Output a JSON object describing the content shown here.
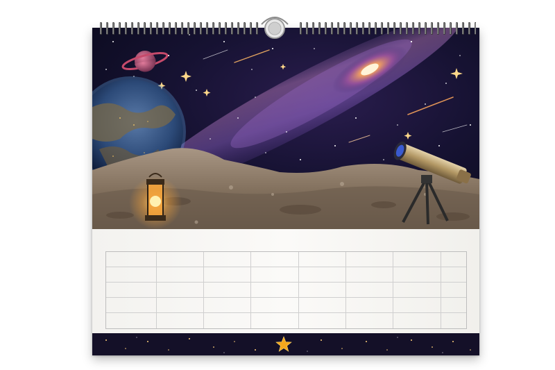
{
  "calendar": {
    "colors": {
      "sky": "#12102a",
      "galaxy": "#8a5fb8",
      "lunar_ground": "#8b7b6c",
      "lantern_glow": "#f6a33a",
      "planet_ring": "#c64a6b",
      "footer": "#141028",
      "star_badge": "#f4a81d"
    },
    "artwork": {
      "elements": [
        "ringed-planet",
        "earth",
        "spiral-galaxy",
        "shooting-stars",
        "lunar-surface",
        "oil-lantern",
        "telescope-on-tripod"
      ]
    },
    "grid": {
      "rows": 5,
      "columns": 8
    },
    "footer": {
      "icon": "star-icon"
    }
  }
}
